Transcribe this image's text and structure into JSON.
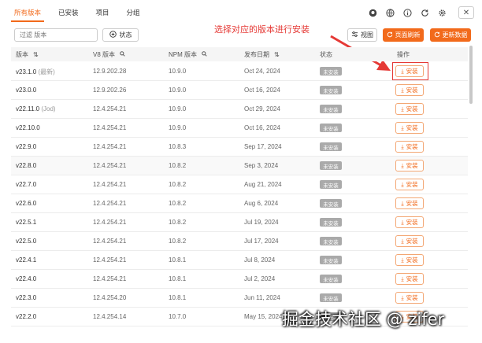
{
  "tabs": [
    {
      "label": "所有版本"
    },
    {
      "label": "已安装"
    },
    {
      "label": "项目"
    },
    {
      "label": "分组"
    }
  ],
  "toolbar": {
    "search_placeholder": "过滤 版本",
    "status_label": "状态",
    "view_label": "视图",
    "refresh_page_label": "页面刷新",
    "update_data_label": "更新数据"
  },
  "annotation": "选择对应的版本进行安装",
  "table": {
    "headers": {
      "version": "版本",
      "v8": "V8 版本",
      "npm": "NPM 版本",
      "date": "发布日期",
      "status": "状态",
      "action": "操作"
    },
    "rows": [
      {
        "version": "v23.1.0",
        "note": "(最新)",
        "v8": "12.9.202.28",
        "npm": "10.9.0",
        "date": "Oct 24, 2024",
        "status": "未安装",
        "action": "安装"
      },
      {
        "version": "v23.0.0",
        "note": "",
        "v8": "12.9.202.26",
        "npm": "10.9.0",
        "date": "Oct 16, 2024",
        "status": "未安装",
        "action": "安装"
      },
      {
        "version": "v22.11.0",
        "note": "(Jod)",
        "v8": "12.4.254.21",
        "npm": "10.9.0",
        "date": "Oct 29, 2024",
        "status": "未安装",
        "action": "安装"
      },
      {
        "version": "v22.10.0",
        "note": "",
        "v8": "12.4.254.21",
        "npm": "10.9.0",
        "date": "Oct 16, 2024",
        "status": "未安装",
        "action": "安装"
      },
      {
        "version": "v22.9.0",
        "note": "",
        "v8": "12.4.254.21",
        "npm": "10.8.3",
        "date": "Sep 17, 2024",
        "status": "未安装",
        "action": "安装"
      },
      {
        "version": "v22.8.0",
        "note": "",
        "v8": "12.4.254.21",
        "npm": "10.8.2",
        "date": "Sep 3, 2024",
        "status": "未安装",
        "action": "安装"
      },
      {
        "version": "v22.7.0",
        "note": "",
        "v8": "12.4.254.21",
        "npm": "10.8.2",
        "date": "Aug 21, 2024",
        "status": "未安装",
        "action": "安装"
      },
      {
        "version": "v22.6.0",
        "note": "",
        "v8": "12.4.254.21",
        "npm": "10.8.2",
        "date": "Aug 6, 2024",
        "status": "未安装",
        "action": "安装"
      },
      {
        "version": "v22.5.1",
        "note": "",
        "v8": "12.4.254.21",
        "npm": "10.8.2",
        "date": "Jul 19, 2024",
        "status": "未安装",
        "action": "安装"
      },
      {
        "version": "v22.5.0",
        "note": "",
        "v8": "12.4.254.21",
        "npm": "10.8.2",
        "date": "Jul 17, 2024",
        "status": "未安装",
        "action": "安装"
      },
      {
        "version": "v22.4.1",
        "note": "",
        "v8": "12.4.254.21",
        "npm": "10.8.1",
        "date": "Jul 8, 2024",
        "status": "未安装",
        "action": "安装"
      },
      {
        "version": "v22.4.0",
        "note": "",
        "v8": "12.4.254.21",
        "npm": "10.8.1",
        "date": "Jul 2, 2024",
        "status": "未安装",
        "action": "安装"
      },
      {
        "version": "v22.3.0",
        "note": "",
        "v8": "12.4.254.20",
        "npm": "10.8.1",
        "date": "Jun 11, 2024",
        "status": "未安装",
        "action": "安装"
      },
      {
        "version": "v22.2.0",
        "note": "",
        "v8": "12.4.254.14",
        "npm": "10.7.0",
        "date": "May 15, 2024",
        "status": "未安装",
        "action": "安装"
      }
    ]
  },
  "watermark": "掘金技术社区 @ zifer",
  "colors": {
    "accent": "#f26a1b",
    "annotation": "#e53935",
    "badge": "#aaaaaa"
  },
  "icons": [
    "github-icon",
    "globe-icon",
    "info-icon",
    "refresh-icon",
    "settings-icon",
    "close-icon",
    "add-circle-icon",
    "view-icon",
    "download-icon",
    "sort-icon",
    "search-icon"
  ]
}
